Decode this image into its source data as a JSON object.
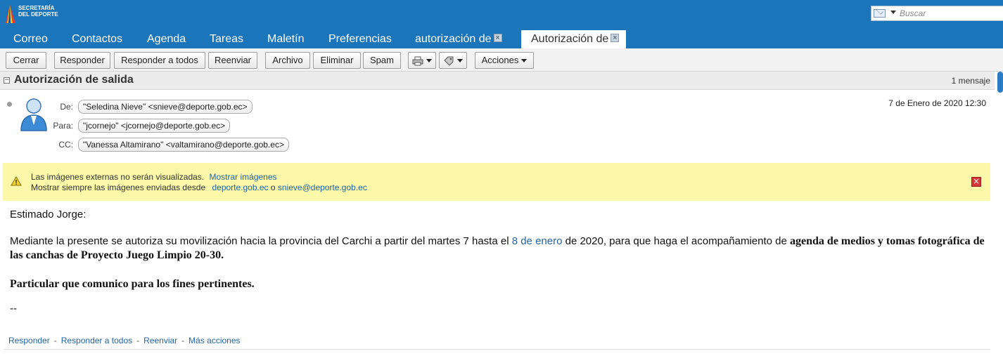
{
  "logo": {
    "line1": "SECRETARÍA",
    "line2": "DEL DEPORTE"
  },
  "search": {
    "placeholder": "Buscar"
  },
  "tabs": [
    {
      "label": "Correo"
    },
    {
      "label": "Contactos"
    },
    {
      "label": "Agenda"
    },
    {
      "label": "Tareas"
    },
    {
      "label": "Maletín"
    },
    {
      "label": "Preferencias"
    },
    {
      "label": "autorización de"
    },
    {
      "label": "Autorización de"
    }
  ],
  "toolbar": {
    "close": "Cerrar",
    "reply": "Responder",
    "reply_all": "Responder a todos",
    "forward": "Reenviar",
    "archive": "Archivo",
    "delete": "Eliminar",
    "spam": "Spam",
    "actions": "Acciones"
  },
  "conversation": {
    "subject": "Autorización de salida",
    "count": "1 mensaje"
  },
  "message": {
    "from_label": "De:",
    "to_label": "Para:",
    "cc_label": "CC:",
    "from": "\"Seledina Nieve\" <snieve@deporte.gob.ec>",
    "to": "\"jcornejo\" <jcornejo@deporte.gob.ec>",
    "cc": "\"Vanessa Altamirano\" <valtamirano@deporte.gob.ec>",
    "date": "7 de Enero de 2020 12:30"
  },
  "warning": {
    "line1_text": "Las imágenes externas no serán visualizadas.",
    "line1_link": "Mostrar imágenes",
    "line2_text": "Mostrar siempre las imágenes enviadas desde",
    "line2_link1": "deporte.gob.ec",
    "line2_or": "o",
    "line2_link2": "snieve@deporte.gob.ec"
  },
  "body": {
    "greeting": "Estimado Jorge:",
    "p1_a": "Mediante la presente se autoriza su movilización hacia la provincia del Carchi a partir del martes 7 hasta el",
    "p1_link": "8 de enero",
    "p1_b": "de 2020, para que haga el acompañamiento de",
    "p1_bold_1": "agenda de medios y tomas",
    "p1_bold_2": "fotográfica de las canchas de Proyecto Juego Limpio 20-30.",
    "p2": "Particular que comunico para los fines pertinentes.",
    "sig": "--"
  },
  "footer": {
    "reply": "Responder",
    "reply_all": "Responder a todos",
    "forward": "Reenviar",
    "more": "Más acciones",
    "sep": "-"
  }
}
